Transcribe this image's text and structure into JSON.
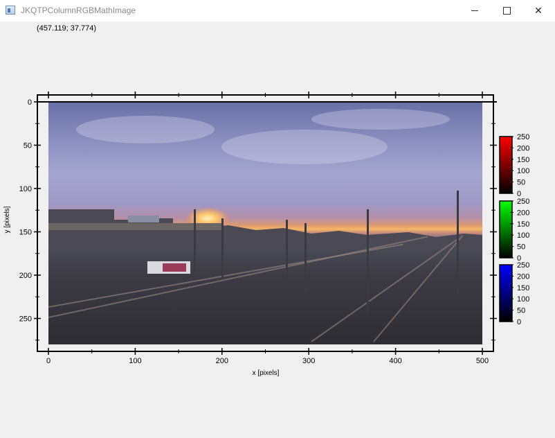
{
  "window": {
    "title": "JKQTPColumnRGBMathImage",
    "minimize_label": "",
    "maximize_label": "",
    "close_label": "✕"
  },
  "coordinate_readout": "(457.119; 37.774)",
  "chart_data": {
    "type": "image",
    "xlabel": "x [pixels]",
    "ylabel": "y [pixels]",
    "xlim": [
      0,
      500
    ],
    "ylim": [
      280,
      0
    ],
    "x_ticks": [
      0,
      100,
      200,
      300,
      400,
      500
    ],
    "y_ticks": [
      0,
      50,
      100,
      150,
      200,
      250
    ],
    "image_extent": {
      "x": [
        0,
        500
      ],
      "y": [
        0,
        280
      ]
    },
    "colorbars": [
      {
        "channel": "red",
        "color": "#ff0000",
        "range": [
          0,
          250
        ],
        "ticks": [
          250,
          200,
          150,
          100,
          50,
          0
        ]
      },
      {
        "channel": "green",
        "color": "#00ff00",
        "range": [
          0,
          250
        ],
        "ticks": [
          250,
          200,
          150,
          100,
          50,
          0
        ]
      },
      {
        "channel": "blue",
        "color": "#0000ff",
        "range": [
          0,
          250
        ],
        "ticks": [
          250,
          200,
          150,
          100,
          50,
          0
        ]
      }
    ]
  }
}
